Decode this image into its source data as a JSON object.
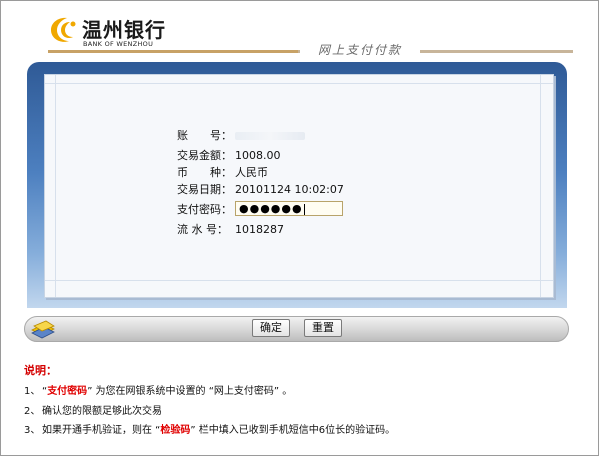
{
  "header": {
    "bank_name_cn": "温州银行",
    "bank_name_en": "BANK OF WENZHOU",
    "page_title": "网上支付付款"
  },
  "form": {
    "account_label": "账　　号：",
    "account_value": "",
    "amount_label": "交易金额：",
    "amount_value": "1008.00",
    "currency_label": "币　　种：",
    "currency_value": "人民币",
    "date_label": "交易日期：",
    "date_value": "20101124 10:02:07",
    "password_label": "支付密码：",
    "password_value": "●●●●●●",
    "serial_label": "流 水 号：",
    "serial_value": "1018287"
  },
  "buttons": {
    "confirm": "确定",
    "reset": "重置"
  },
  "notes": {
    "title": "说明：",
    "items": [
      {
        "num": "1、",
        "pre": "“",
        "hl": "支付密码",
        "post": "” 为您在网银系统中设置的 “网上支付密码” 。"
      },
      {
        "num": "2、",
        "text": "确认您的限额足够此次交易"
      },
      {
        "num": "3、",
        "pre": "如果开通手机验证，则在 “",
        "hl": "检验码",
        "post": "” 栏中填入已收到手机短信中6位长的验证码。"
      }
    ]
  },
  "colors": {
    "brand_gold": "#f0a800",
    "panel_blue": "#2f5a96",
    "note_red": "#d40000"
  }
}
